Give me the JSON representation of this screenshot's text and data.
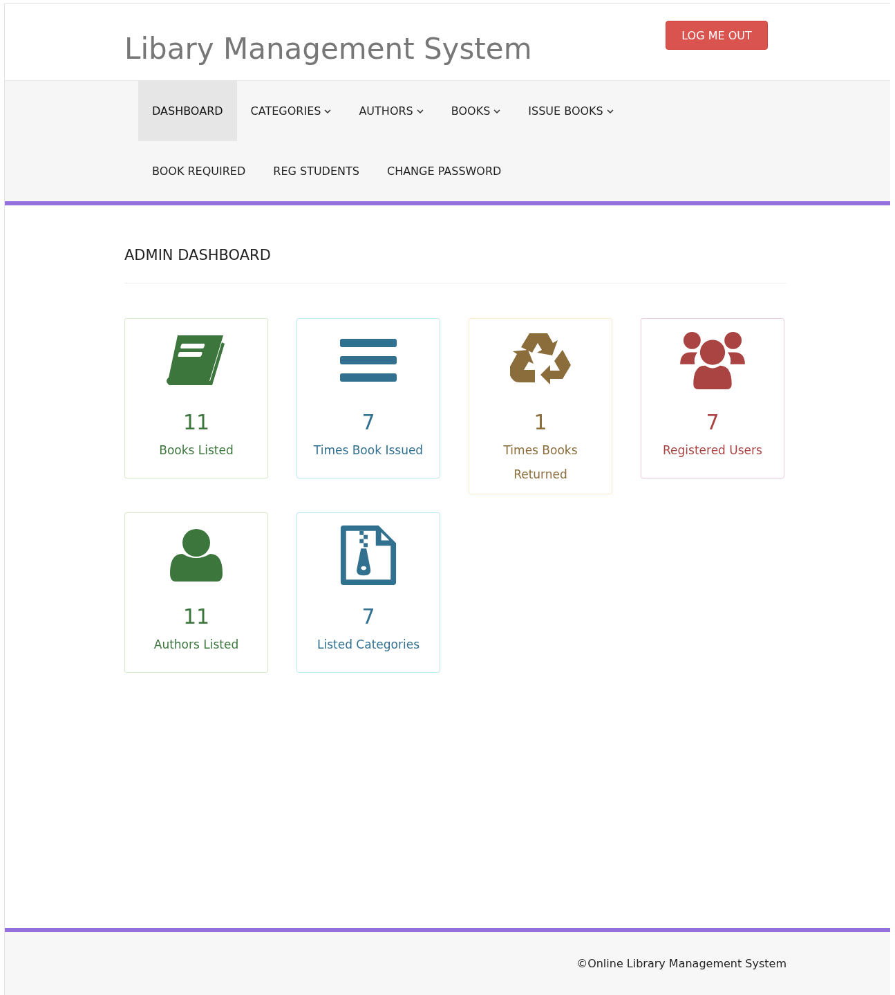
{
  "header": {
    "title": "Libary Management System",
    "logout_button": "LOG ME OUT"
  },
  "nav": [
    [
      {
        "label": "DASHBOARD",
        "selected": true,
        "dropdown": false
      },
      {
        "label": "CATEGORIES",
        "selected": false,
        "dropdown": true
      },
      {
        "label": "AUTHORS",
        "selected": false,
        "dropdown": true
      },
      {
        "label": "BOOKS",
        "selected": false,
        "dropdown": true
      },
      {
        "label": "ISSUE BOOKS",
        "selected": false,
        "dropdown": true
      }
    ],
    [
      {
        "label": "BOOK REQUIRED",
        "selected": false,
        "dropdown": false
      },
      {
        "label": "REG STUDENTS",
        "selected": false,
        "dropdown": false
      },
      {
        "label": "CHANGE PASSWORD",
        "selected": false,
        "dropdown": false
      }
    ]
  ],
  "heading": "ADMIN DASHBOARD",
  "cards": [
    [
      {
        "kind": "success",
        "count": "11",
        "label": "Books Listed"
      },
      {
        "kind": "info",
        "count": "7",
        "label": "Times Book Issued"
      },
      {
        "kind": "warning",
        "count": "1",
        "label": "Times Books Returned"
      },
      {
        "kind": "danger",
        "count": "7",
        "label": "Registered Users"
      }
    ],
    [
      {
        "kind": "success",
        "count": "11",
        "label": "Authors Listed"
      },
      {
        "kind": "info",
        "count": "7",
        "label": "Listed Categories"
      }
    ]
  ],
  "footer": "©Online Library Management System"
}
